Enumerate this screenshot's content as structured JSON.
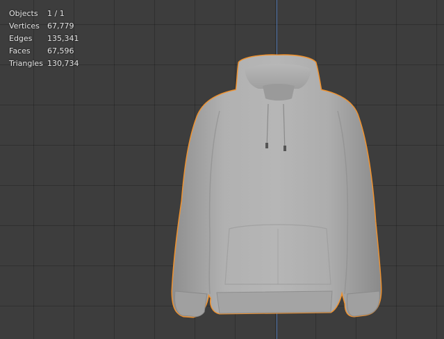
{
  "stats": {
    "rows": [
      {
        "label": "Objects",
        "value": "1 / 1"
      },
      {
        "label": "Vertices",
        "value": "67,779"
      },
      {
        "label": "Edges",
        "value": "135,341"
      },
      {
        "label": "Faces",
        "value": "67,596"
      },
      {
        "label": "Triangles",
        "value": "130,734"
      }
    ]
  },
  "colors": {
    "background": "#3d3d3d",
    "selection_outline": "#f0922e",
    "y_axis": "#4a6fa8",
    "mesh": "#a9a9a9"
  },
  "viewport": {
    "selected_object": "hoodie-mesh"
  }
}
